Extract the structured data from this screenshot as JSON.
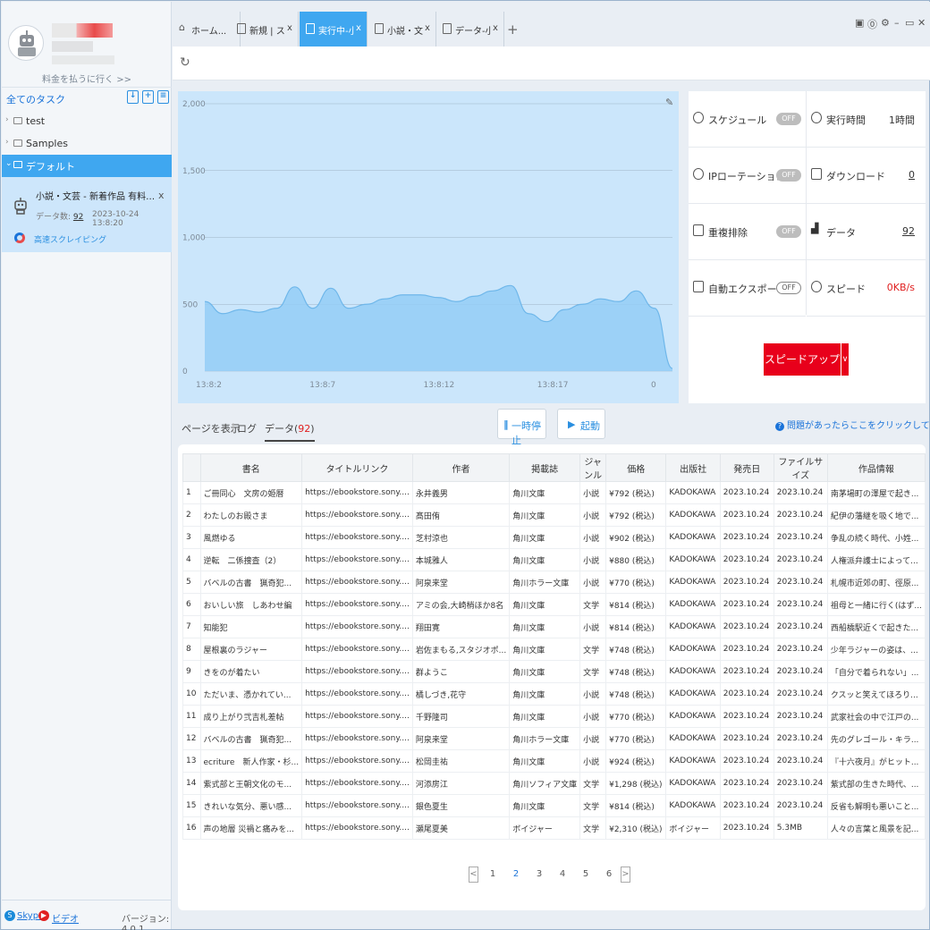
{
  "sidebar": {
    "pay_link": "料金を払うに行く >>",
    "all_tasks": "全てのタスク",
    "tree": [
      {
        "label": "test"
      },
      {
        "label": "Samples"
      },
      {
        "label": "デフォルト"
      }
    ],
    "task": {
      "title": "小説・文芸 - 新着作品 有料 | ソニーの電子...",
      "close": "x",
      "data_label": "データ数: ",
      "data_count": "92",
      "date": "2023-10-24 13:8:20",
      "speed_label": "高速スクレイピング"
    },
    "footer": {
      "skype": "Skype",
      "video": "ビデオ",
      "version": "バージョン: 4.0.1"
    }
  },
  "tabs": [
    {
      "label": "ホーム...",
      "close": ""
    },
    {
      "label": "新規 | スマ...",
      "close": "x"
    },
    {
      "label": "実行中-小...",
      "close": "x"
    },
    {
      "label": "小説・文...",
      "close": "x"
    },
    {
      "label": "データ-小...",
      "close": "x"
    }
  ],
  "tab_plus": "+",
  "chart_data": {
    "type": "area",
    "y_ticks": [
      "2,000",
      "1,500",
      "1,000",
      "500",
      "0"
    ],
    "x_ticks": [
      "13:8:2",
      "13:8:7",
      "13:8:12",
      "13:8:17",
      "0"
    ],
    "ylim": [
      0,
      2000
    ],
    "grid": true,
    "x": [
      0,
      1,
      2,
      3,
      4,
      5,
      6,
      7,
      8,
      9,
      10,
      11,
      12,
      13,
      14,
      15,
      16,
      17,
      18,
      19,
      20,
      21,
      22,
      23,
      24,
      25,
      26
    ],
    "values": [
      520,
      430,
      460,
      440,
      470,
      630,
      470,
      620,
      470,
      500,
      540,
      570,
      570,
      550,
      520,
      560,
      600,
      640,
      430,
      370,
      460,
      500,
      540,
      520,
      600,
      470,
      20
    ]
  },
  "stats": {
    "schedule": {
      "label": "スケジュール",
      "toggle": "OFF"
    },
    "exec_time": {
      "label": "実行時間",
      "value": "1時間"
    },
    "ip_rotation": {
      "label": "IPローテーション",
      "toggle": "OFF"
    },
    "download": {
      "label": "ダウンロード",
      "value": "0"
    },
    "dedup": {
      "label": "重複排除",
      "toggle": "OFF"
    },
    "data": {
      "label": "データ",
      "value": "92"
    },
    "auto_export": {
      "label": "自動エクスポート",
      "toggle": "OFF"
    },
    "speed": {
      "label": "スピード",
      "value": "0KB/s"
    },
    "speedup_button": "スピードアップ",
    "speedup_arrow": "∨"
  },
  "controls": {
    "view_page": "ページを表示",
    "log": "ログ",
    "data_tab": "データ(",
    "data_count": "92",
    "data_close": ")",
    "pause": "一時停止",
    "start": "起動",
    "help": "問題があったらここをクリックしてください"
  },
  "table": {
    "columns": [
      "",
      "書名",
      "タイトルリンク",
      "作者",
      "掲載誌",
      "ジャンル",
      "価格",
      "出版社",
      "発売日",
      "ファイルサイズ",
      "作品情報"
    ],
    "rows": [
      [
        "1",
        "ご冊同心　文房の姫暦",
        "https://ebookstore.sony....",
        "永井義男",
        "角川文庫",
        "小説",
        "¥792 (税込)",
        "KADOKAWA",
        "2023.10.24",
        "2023.10.24",
        "南茅場町の澤屋で起き..."
      ],
      [
        "2",
        "わたしのお殿さま",
        "https://ebookstore.sony....",
        "髙田侑",
        "角川文庫",
        "小説",
        "¥792 (税込)",
        "KADOKAWA",
        "2023.10.24",
        "2023.10.24",
        "紀伊の藩継を吸く地で..."
      ],
      [
        "3",
        "風燃ゆる",
        "https://ebookstore.sony....",
        "芝村涼也",
        "角川文庫",
        "小説",
        "¥902 (税込)",
        "KADOKAWA",
        "2023.10.24",
        "2023.10.24",
        "争乱の続く時代、小姓..."
      ],
      [
        "4",
        "逆転　二係捜査（2）",
        "https://ebookstore.sony....",
        "本城雅人",
        "角川文庫",
        "小説",
        "¥880 (税込)",
        "KADOKAWA",
        "2023.10.24",
        "2023.10.24",
        "人権派弁護士によって..."
      ],
      [
        "5",
        "バベルの古書　猟奇犯...",
        "https://ebookstore.sony....",
        "阿泉来堂",
        "角川ホラー文庫",
        "小説",
        "¥770 (税込)",
        "KADOKAWA",
        "2023.10.24",
        "2023.10.24",
        "札幌市近郊の町、徑原..."
      ],
      [
        "6",
        "おいしい旅　しあわせ編",
        "https://ebookstore.sony....",
        "アミの会,大崎梢ほか8名",
        "角川文庫",
        "文学",
        "¥814 (税込)",
        "KADOKAWA",
        "2023.10.24",
        "2023.10.24",
        "祖母と一緒に行く(はず..."
      ],
      [
        "7",
        "知能犯",
        "https://ebookstore.sony....",
        "翔田寛",
        "角川文庫",
        "小説",
        "¥814 (税込)",
        "KADOKAWA",
        "2023.10.24",
        "2023.10.24",
        "西船橋駅近くで起きた..."
      ],
      [
        "8",
        "屋根裏のラジャー",
        "https://ebookstore.sony....",
        "岩佐まもる,スタジオポ...",
        "角川文庫",
        "文学",
        "¥748 (税込)",
        "KADOKAWA",
        "2023.10.24",
        "2023.10.24",
        "少年ラジャーの姿は、..."
      ],
      [
        "9",
        "きをのが着たい",
        "https://ebookstore.sony....",
        "群ようこ",
        "角川文庫",
        "文学",
        "¥748 (税込)",
        "KADOKAWA",
        "2023.10.24",
        "2023.10.24",
        "「自分で着られない」..."
      ],
      [
        "10",
        "ただいま、憑かれてい...",
        "https://ebookstore.sony....",
        "橘しづき,花守",
        "角川文庫",
        "小説",
        "¥748 (税込)",
        "KADOKAWA",
        "2023.10.24",
        "2023.10.24",
        "クスッと笑えてほろり..."
      ],
      [
        "11",
        "成り上がり弐吉札差帖",
        "https://ebookstore.sony....",
        "千野隆司",
        "角川文庫",
        "小説",
        "¥770 (税込)",
        "KADOKAWA",
        "2023.10.24",
        "2023.10.24",
        "武家社会の中で江戸の..."
      ],
      [
        "12",
        "バベルの古書　猟奇犯...",
        "https://ebookstore.sony....",
        "阿泉来堂",
        "角川ホラー文庫",
        "小説",
        "¥770 (税込)",
        "KADOKAWA",
        "2023.10.24",
        "2023.10.24",
        "先のグレゴール・キラ..."
      ],
      [
        "13",
        "ecriture　新人作家・杉...",
        "https://ebookstore.sony....",
        "松岡圭祐",
        "角川文庫",
        "小説",
        "¥924 (税込)",
        "KADOKAWA",
        "2023.10.24",
        "2023.10.24",
        "『十六夜月』がヒット..."
      ],
      [
        "14",
        "紫式部と王朝文化のモ...",
        "https://ebookstore.sony....",
        "河添房江",
        "角川ソフィア文庫",
        "文学",
        "¥1,298 (税込)",
        "KADOKAWA",
        "2023.10.24",
        "2023.10.24",
        "紫式部の生きた時代、..."
      ],
      [
        "15",
        "きれいな気分、悪い感...",
        "https://ebookstore.sony....",
        "銀色夏生",
        "角川文庫",
        "文学",
        "¥814 (税込)",
        "KADOKAWA",
        "2023.10.24",
        "2023.10.24",
        "反省も解明も悪いこと..."
      ],
      [
        "16",
        "声の地層 災禍と痛みを...",
        "https://ebookstore.sony....",
        "瀬尾夏美",
        "ボイジャー",
        "文学",
        "¥2,310 (税込)",
        "ボイジャー",
        "2023.10.24",
        "5.3MB",
        "人々の言葉と風景を記..."
      ]
    ]
  },
  "pager": {
    "pages": [
      "1",
      "2",
      "3",
      "4",
      "5",
      "6"
    ],
    "current": "2",
    "prev": "<",
    "next": ">"
  }
}
